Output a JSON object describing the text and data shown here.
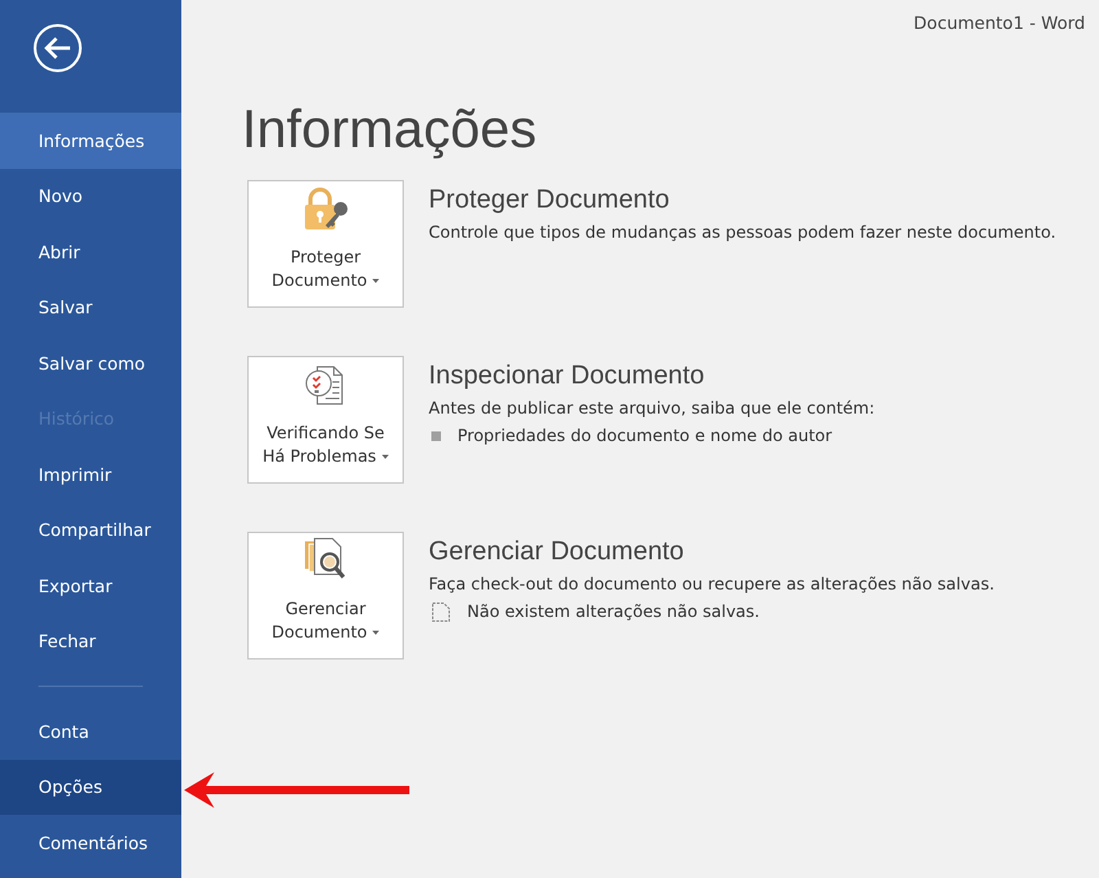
{
  "window": {
    "title": "Documento1 - Word"
  },
  "sidebar": {
    "items": [
      {
        "label": "Informações",
        "selected": true,
        "disabled": false,
        "highlighted": false
      },
      {
        "label": "Novo",
        "selected": false,
        "disabled": false,
        "highlighted": false
      },
      {
        "label": "Abrir",
        "selected": false,
        "disabled": false,
        "highlighted": false
      },
      {
        "label": "Salvar",
        "selected": false,
        "disabled": false,
        "highlighted": false
      },
      {
        "label": "Salvar como",
        "selected": false,
        "disabled": false,
        "highlighted": false
      },
      {
        "label": "Histórico",
        "selected": false,
        "disabled": true,
        "highlighted": false
      },
      {
        "label": "Imprimir",
        "selected": false,
        "disabled": false,
        "highlighted": false
      },
      {
        "label": "Compartilhar",
        "selected": false,
        "disabled": false,
        "highlighted": false
      },
      {
        "label": "Exportar",
        "selected": false,
        "disabled": false,
        "highlighted": false
      },
      {
        "label": "Fechar",
        "selected": false,
        "disabled": false,
        "highlighted": false
      }
    ],
    "footer_items": [
      {
        "label": "Conta",
        "selected": false,
        "disabled": false,
        "highlighted": false
      },
      {
        "label": "Opções",
        "selected": false,
        "disabled": false,
        "highlighted": true
      },
      {
        "label": "Comentários",
        "selected": false,
        "disabled": false,
        "highlighted": false
      }
    ]
  },
  "page": {
    "title": "Informações",
    "sections": [
      {
        "kind": "lock",
        "button_lines": [
          "Proteger",
          "Documento"
        ],
        "title": "Proteger Documento",
        "description": "Controle que tipos de mudanças as pessoas podem fazer neste documento."
      },
      {
        "kind": "checklist",
        "button_lines": [
          "Verificando Se",
          "Há Problemas"
        ],
        "title": "Inspecionar Documento",
        "description": "Antes de publicar este arquivo, saiba que ele contém:",
        "notes": [
          {
            "kind": "bullet",
            "text": "Propriedades do documento e nome do autor"
          }
        ]
      },
      {
        "kind": "manage",
        "button_lines": [
          "Gerenciar",
          "Documento"
        ],
        "title": "Gerenciar Documento",
        "description": "Faça check-out do documento ou recupere as alterações não salvas.",
        "notes": [
          {
            "kind": "document",
            "text": "Não existem alterações não salvas."
          }
        ]
      }
    ]
  },
  "annotation": {
    "kind": "arrow"
  }
}
